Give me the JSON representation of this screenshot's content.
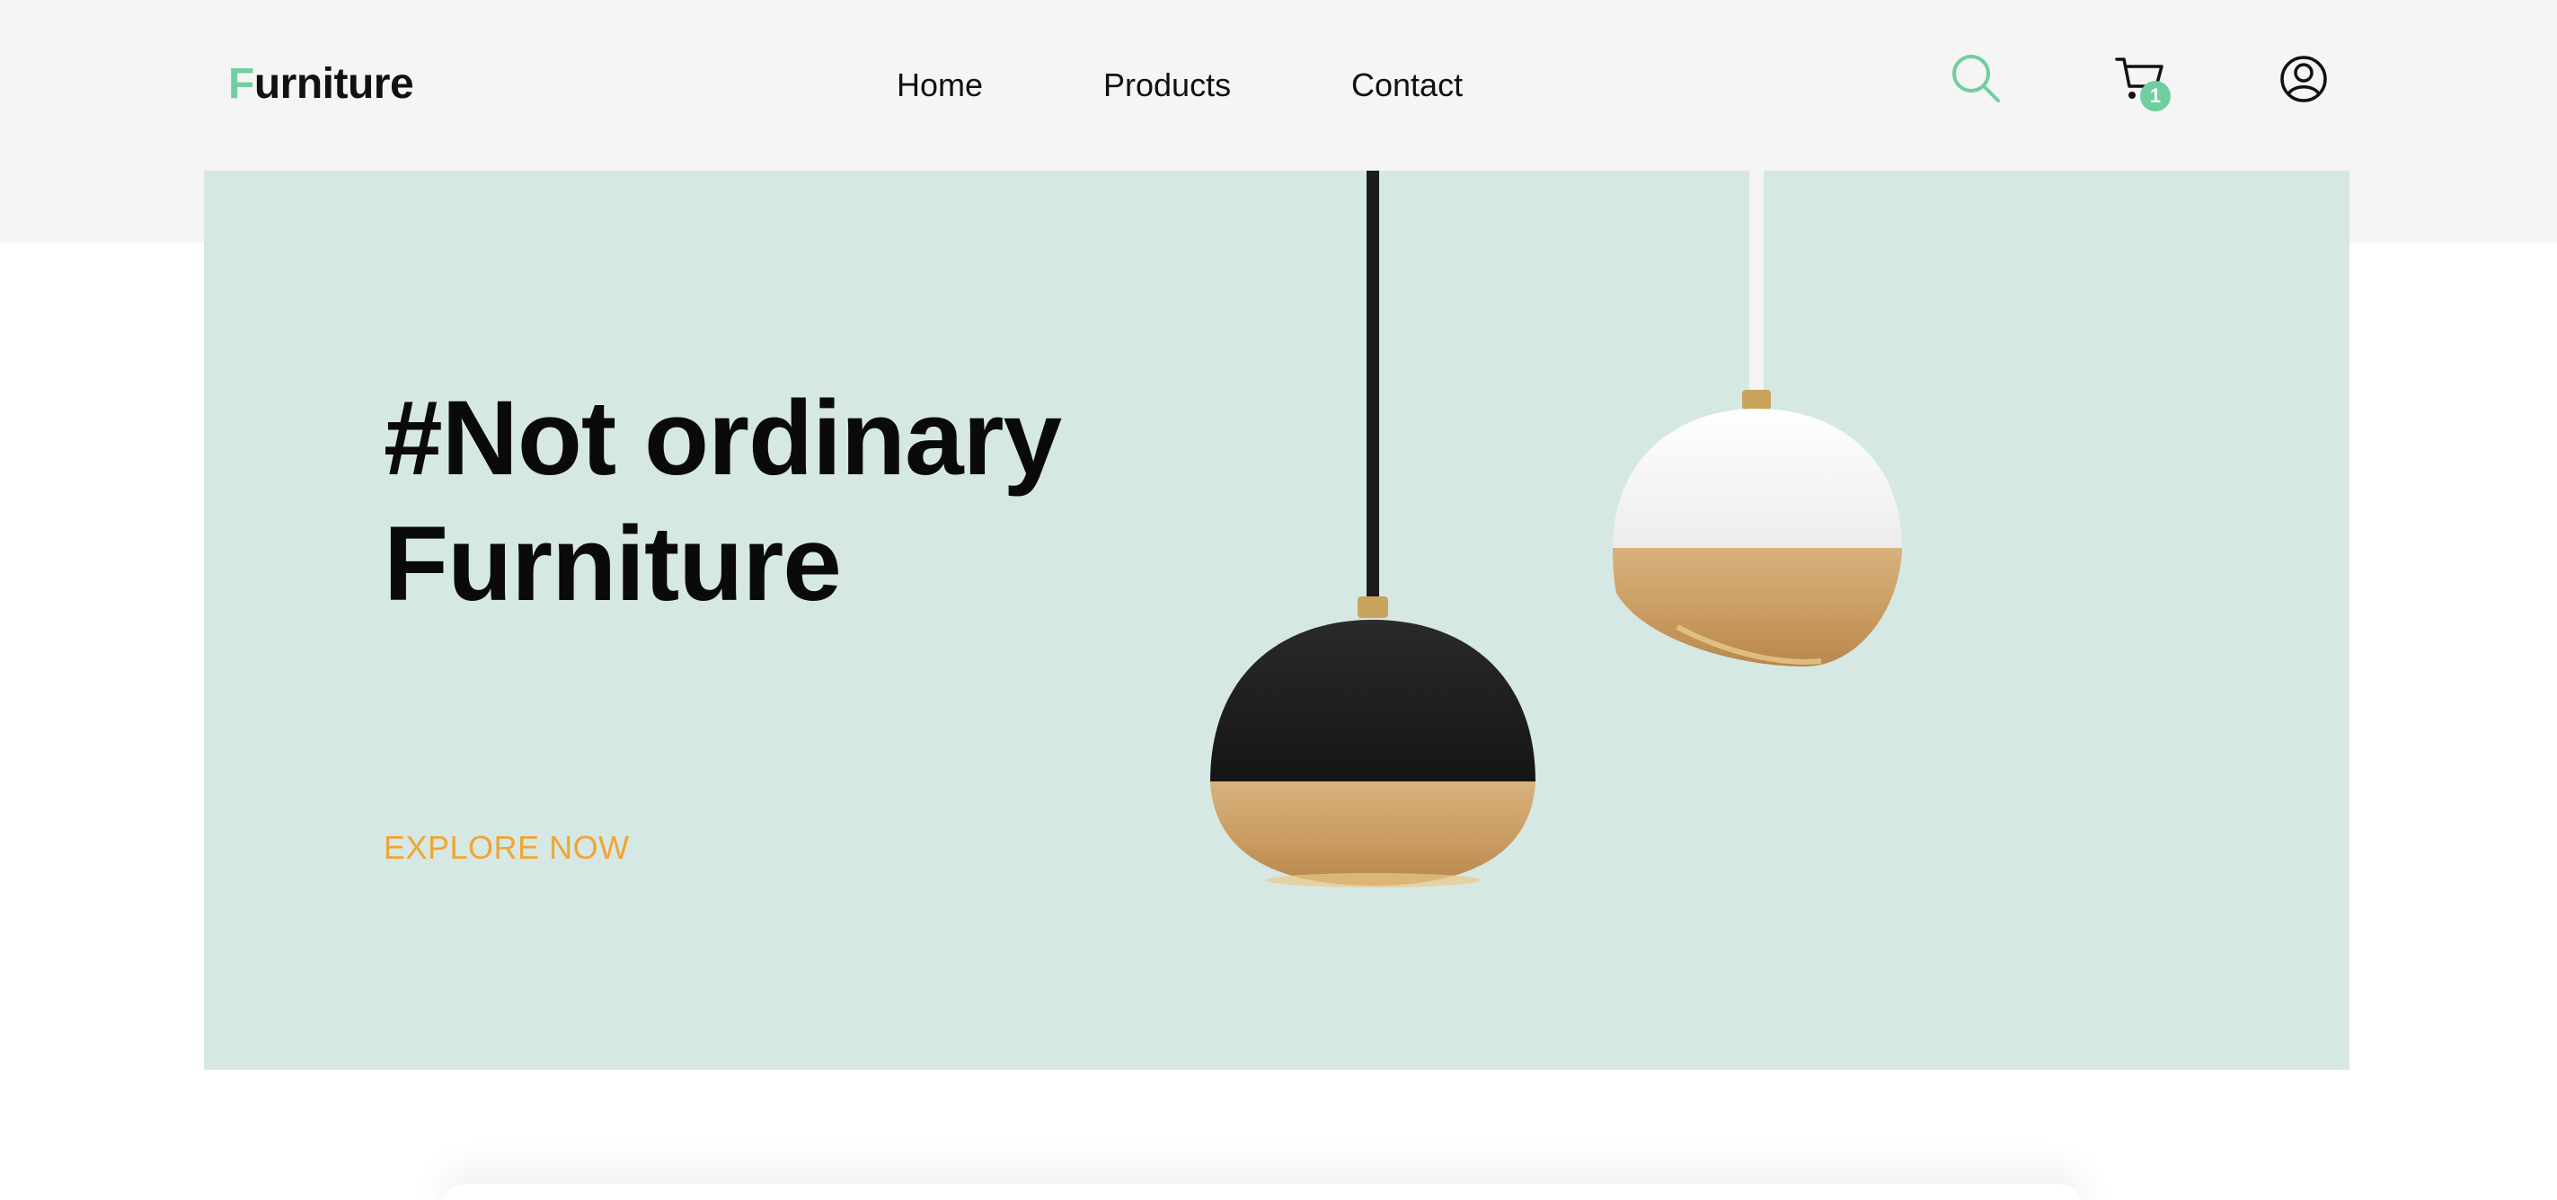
{
  "brand": {
    "logo_first_letter": "F",
    "logo_rest": "urniture",
    "accent_color": "#6fcf9f"
  },
  "nav": {
    "items": [
      {
        "label": "Home"
      },
      {
        "label": "Products"
      },
      {
        "label": "Contact"
      }
    ]
  },
  "header_icons": {
    "search": "search-icon",
    "cart": "cart-icon",
    "cart_count": "1",
    "user": "user-icon"
  },
  "hero": {
    "title_line1": "#Not ordinary",
    "title_line2": "Furniture",
    "cta_label": "EXPLORE NOW",
    "cta_color": "#f0a535",
    "background_color": "#d6e8e4",
    "image": "pendant-lamps-image"
  }
}
